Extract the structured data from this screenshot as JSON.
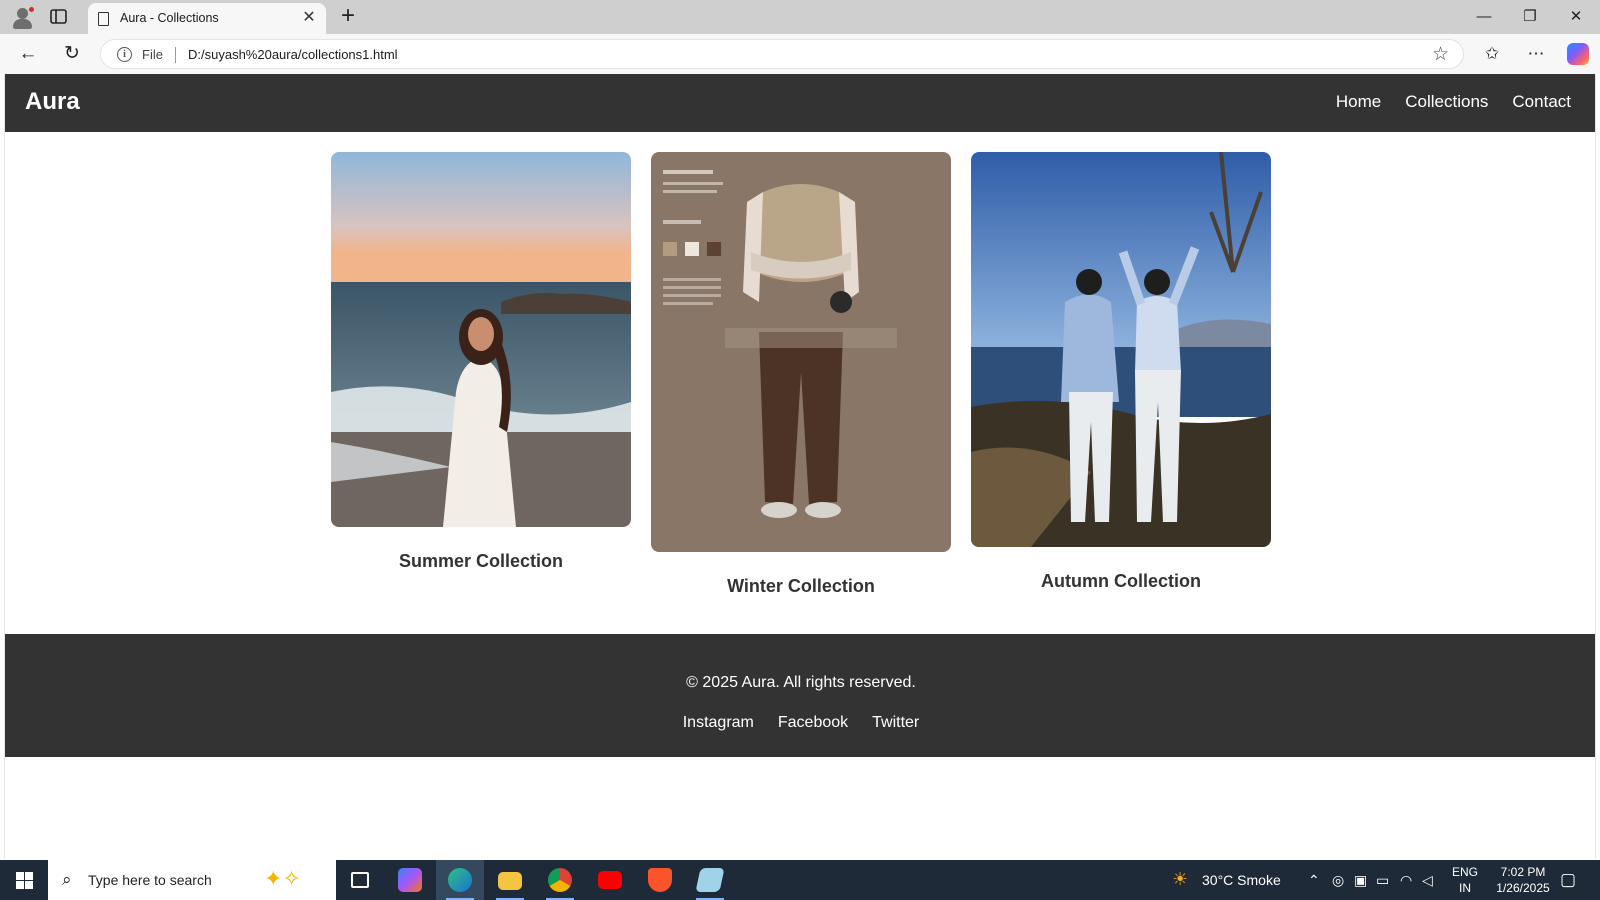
{
  "browser": {
    "tab_title": "Aura - Collections",
    "address_prefix": "File",
    "url": "D:/suyash%20aura/collections1.html",
    "icons": [
      "profile-icon",
      "tab-actions-icon",
      "page-icon",
      "close-icon",
      "new-tab-icon",
      "minimize-icon",
      "restore-icon",
      "window-close-icon",
      "back-icon",
      "reload-icon",
      "info-icon",
      "favorite-star-icon",
      "favorites-icon",
      "more-icon",
      "copilot-icon"
    ]
  },
  "site": {
    "logo": "Aura",
    "nav": [
      "Home",
      "Collections",
      "Contact"
    ],
    "collections": [
      {
        "caption": "Summer Collection",
        "image": "woman in white dress on beach at sunset"
      },
      {
        "caption": "Winter Collection",
        "image": "flat-lay outfit: beige knit vest, brown trousers"
      },
      {
        "caption": "Autumn Collection",
        "image": "couple in light blue outfits by a lake"
      }
    ],
    "footer": {
      "copyright": "© 2025 Aura. All rights reserved.",
      "social": [
        "Instagram",
        "Facebook",
        "Twitter"
      ]
    }
  },
  "taskbar": {
    "search_placeholder": "Type here to search",
    "weather": "30°C  Smoke",
    "lang_line1": "ENG",
    "lang_line2": "IN",
    "time": "7:02 PM",
    "date": "1/26/2025",
    "apps": [
      "task-view-icon",
      "copilot-app-icon",
      "edge-icon",
      "file-explorer-icon",
      "chrome-icon",
      "youtube-icon",
      "brave-icon",
      "notepad-icon"
    ]
  },
  "colors": {
    "header_bg": "#333333",
    "footer_bg": "#333333",
    "taskbar_bg": "#1f2a38"
  }
}
